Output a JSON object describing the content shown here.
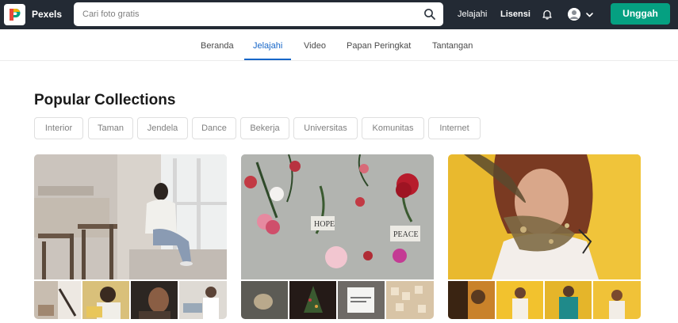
{
  "brand": {
    "name": "Pexels"
  },
  "search": {
    "placeholder": "Cari foto gratis"
  },
  "topnav": {
    "explore": "Jelajahi",
    "license": "Lisensi",
    "upload": "Unggah"
  },
  "tabs": [
    {
      "label": "Beranda",
      "active": false
    },
    {
      "label": "Jelajahi",
      "active": true
    },
    {
      "label": "Video",
      "active": false
    },
    {
      "label": "Papan Peringkat",
      "active": false
    },
    {
      "label": "Tantangan",
      "active": false
    }
  ],
  "section": {
    "title": "Popular Collections"
  },
  "chips": [
    "Interior",
    "Taman",
    "Jendela",
    "Dance",
    "Bekerja",
    "Universitas",
    "Komunitas",
    "Internet"
  ],
  "collections": [
    {
      "cover": "woman-by-window-photo",
      "thumbs": [
        "interior-room-photo",
        "woman-laptop-photo",
        "portrait-dark-photo",
        "people-at-desk-photo"
      ]
    },
    {
      "cover": "flowers-hope-peace-photo",
      "thumbs": [
        "pebble-photo",
        "christmas-tree-photo",
        "note-card-photo",
        "letter-tiles-photo"
      ]
    },
    {
      "cover": "woman-dried-flowers-photo",
      "thumbs": [
        "shadow-portrait-photo",
        "man-yellow-wall-photo",
        "man-teal-jacket-photo",
        "man-yellow-backdrop-photo"
      ]
    }
  ],
  "colors": {
    "topbar": "#232a34",
    "accent": "#05a081",
    "active_tab": "#1666c8"
  },
  "icons": [
    "pexels-logo-icon",
    "search-icon",
    "bell-icon",
    "chevron-down-icon"
  ]
}
